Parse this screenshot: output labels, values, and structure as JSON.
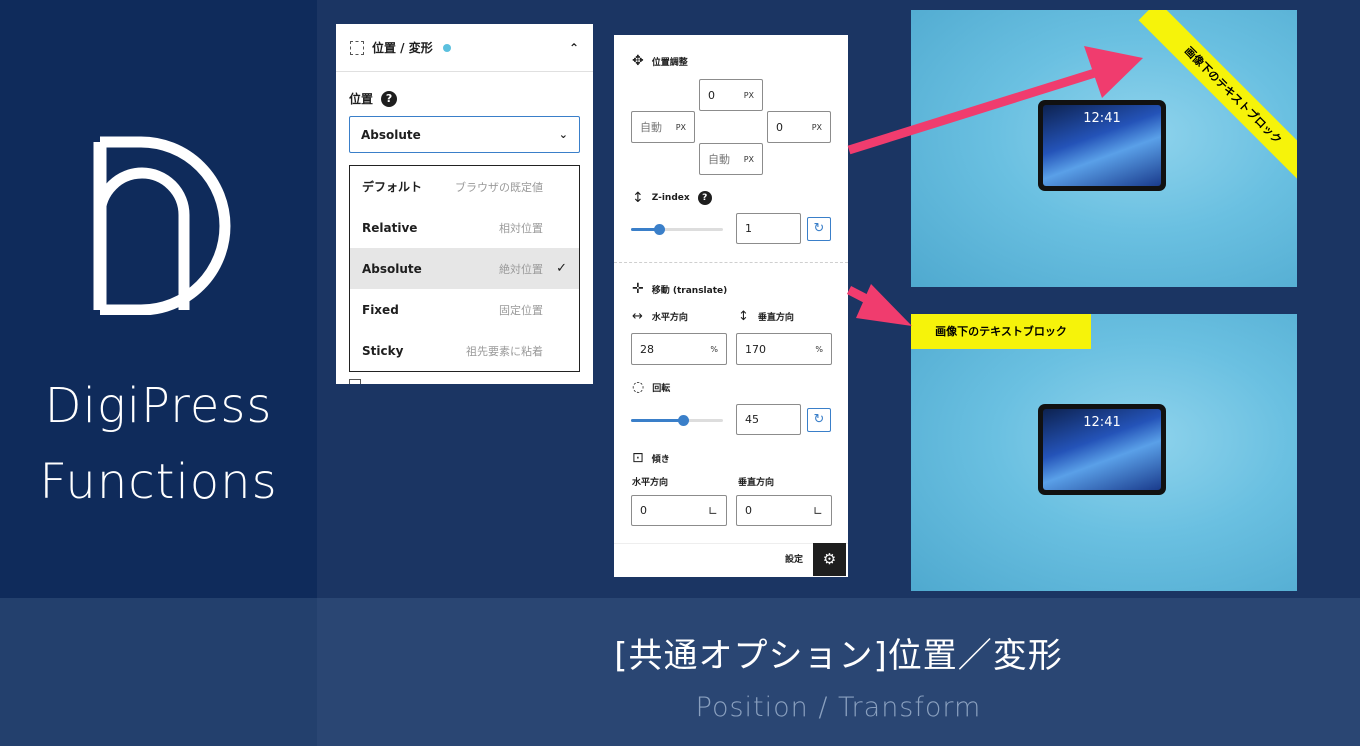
{
  "brand": {
    "line1": "DigiPress",
    "line2": "Functions"
  },
  "caption": {
    "main": "[共通オプション]位置／変形",
    "sub": "Position / Transform"
  },
  "colors": {
    "accent": "#3a7fc9",
    "badge": "#5bc0de",
    "highlight": "#f6f30a",
    "arrow": "#f03c6e"
  },
  "panel1": {
    "header": {
      "title": "位置 / 変形",
      "icon": "dotted-square-icon",
      "chevron": "⌃"
    },
    "position_label": "位置",
    "help": "?",
    "select": {
      "value": "Absolute",
      "chevron": "⌄"
    },
    "options": [
      {
        "label": "デフォルト",
        "desc": "ブラウザの既定値",
        "selected": false
      },
      {
        "label": "Relative",
        "desc": "相対位置",
        "selected": false
      },
      {
        "label": "Absolute",
        "desc": "絶対位置",
        "selected": true
      },
      {
        "label": "Fixed",
        "desc": "固定位置",
        "selected": false
      },
      {
        "label": "Sticky",
        "desc": "祖先要素に粘着",
        "selected": false
      }
    ],
    "check": "✓"
  },
  "panel2": {
    "position": {
      "title": "位置調整",
      "top": {
        "value": "0",
        "unit": "PX"
      },
      "left": {
        "value": "自動",
        "unit": "PX"
      },
      "right": {
        "value": "0",
        "unit": "PX"
      },
      "bottom": {
        "value": "自動",
        "unit": "PX"
      }
    },
    "zindex": {
      "title": "Z-index",
      "help": "?",
      "value": "1",
      "slider_fraction": 0.3
    },
    "translate": {
      "title": "移動 (translate)",
      "horizontal_label": "水平方向",
      "vertical_label": "垂直方向",
      "horizontal": {
        "value": "28",
        "unit": "%"
      },
      "vertical": {
        "value": "170",
        "unit": "%"
      }
    },
    "rotate": {
      "title": "回転",
      "value": "45",
      "slider_fraction": 0.56
    },
    "skew": {
      "title": "傾き",
      "horizontal_label": "水平方向",
      "vertical_label": "垂直方向",
      "horizontal": {
        "value": "0",
        "unit": "∟"
      },
      "vertical": {
        "value": "0",
        "unit": "∟"
      }
    },
    "footer": {
      "settings_label": "設定",
      "gear": "⚙"
    },
    "reset": "↻"
  },
  "preview": {
    "clock": "12:41",
    "ribbon_text": "画像下のテキストブロック",
    "tag_text": "画像下のテキストブロック"
  }
}
